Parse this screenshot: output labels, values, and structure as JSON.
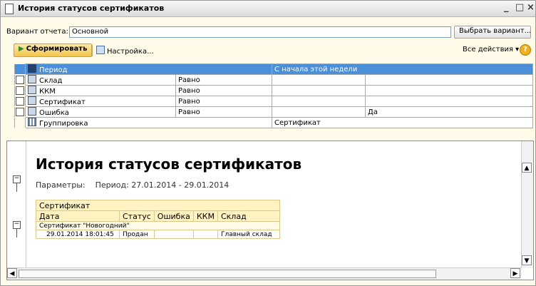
{
  "window": {
    "title": "История статусов сертификатов",
    "controls": [
      "_",
      "□",
      "×"
    ]
  },
  "variant": {
    "label": "Вариант отчета:",
    "value": "Основной",
    "choose_button": "Выбрать вариант..."
  },
  "toolbar": {
    "generate_button": "Сформировать",
    "settings_button": "Настройка...",
    "all_actions": "Все действия ▾",
    "help_icon": "question-icon"
  },
  "settings": {
    "head": {
      "name": "Период",
      "value": "С начала этой недели"
    },
    "rows": [
      {
        "name": "Склад",
        "condition": "Равно",
        "value": "",
        "extra": ""
      },
      {
        "name": "ККМ",
        "condition": "Равно",
        "value": "",
        "extra": ""
      },
      {
        "name": "Сертификат",
        "condition": "Равно",
        "value": "",
        "extra": ""
      },
      {
        "name": "Ошибка",
        "condition": "Равно",
        "value": "",
        "extra": "Да"
      }
    ],
    "grouping": {
      "name": "Группировка",
      "value": "Сертификат"
    }
  },
  "report": {
    "title": "История статусов сертификатов",
    "params_label": "Параметры:",
    "params_value": "Период: 27.01.2014 - 29.01.2014",
    "group_header": "Сертификат",
    "columns": [
      "Дата",
      "Статус",
      "Ошибка",
      "ККМ",
      "Склад"
    ],
    "group_row": "Сертификат \"Новогодний\"",
    "rows": [
      {
        "date": "29.01.2014 18:01:45",
        "status": "Продан",
        "error": "",
        "kkm": "",
        "warehouse": "Главный склад"
      }
    ]
  }
}
